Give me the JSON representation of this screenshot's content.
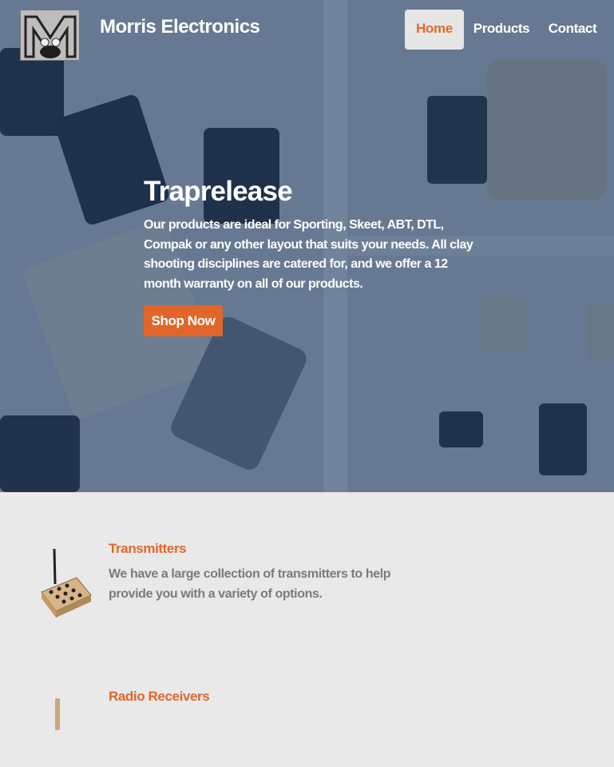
{
  "navbar": {
    "brand": "Morris Electronics",
    "links": [
      {
        "label": "Home",
        "active": true
      },
      {
        "label": "Products",
        "active": false
      },
      {
        "label": "Contact",
        "active": false
      }
    ],
    "logo_icon": "mouse-logo-icon"
  },
  "hero": {
    "title": "Traprelease",
    "description": "Our products are ideal for Sporting, Skeet, ABT, DTL, Compak or any other layout that suits your needs. All clay shooting disciplines are catered for, and we offer a 12 month warranty on all of our products.",
    "cta_label": "Shop Now",
    "overlay_color": "#16345f"
  },
  "features": [
    {
      "title": "Transmitters",
      "description": "We have a large collection of transmitters to help provide you with a variety of options.",
      "icon": "transmitter-icon"
    },
    {
      "title": "Radio Receivers",
      "description": "",
      "icon": "receiver-icon"
    }
  ],
  "colors": {
    "accent": "#e2662a",
    "page_bg": "#e9e9e9",
    "muted_text": "#7b7b7b"
  }
}
